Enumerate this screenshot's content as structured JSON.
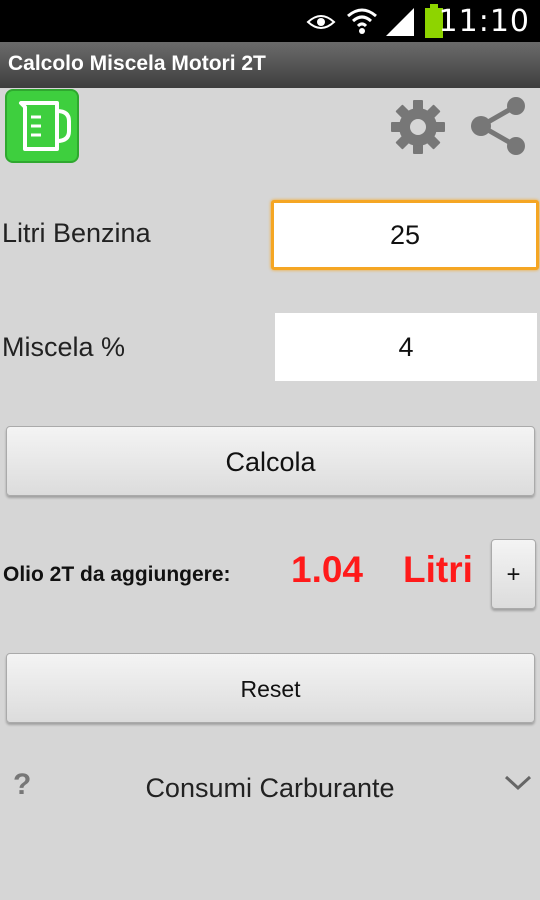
{
  "status_bar": {
    "time": "11:10",
    "icons": [
      "eye-icon",
      "wifi-icon",
      "signal-icon",
      "battery-icon"
    ]
  },
  "app": {
    "title": "Calcolo Miscela Motori 2T",
    "brand_color": "#3ecf3e"
  },
  "toolbar": {
    "icons": [
      "measuring-jug-icon",
      "gear-icon",
      "share-icon"
    ]
  },
  "form": {
    "litri_label": "Litri Benzina",
    "litri_value": "25",
    "miscela_label": "Miscela %",
    "miscela_value": "4",
    "calcola_label": "Calcola"
  },
  "result": {
    "label": "Olio 2T da aggiungere:",
    "value": "1.04",
    "unit": "Litri",
    "plus_label": "+",
    "color": "#ff1a1a"
  },
  "reset_label": "Reset",
  "section": {
    "help_mark": "?",
    "title": "Consumi Carburante"
  },
  "accent_color": "#f5a623"
}
